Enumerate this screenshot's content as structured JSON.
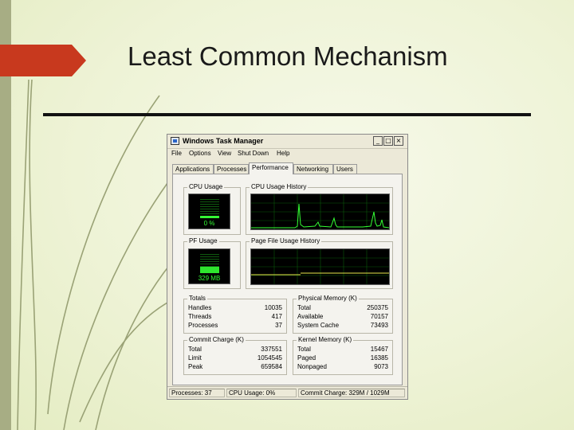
{
  "slide": {
    "title": "Least Common Mechanism",
    "accent_color": "#c8391e"
  },
  "window": {
    "title": "Windows Task Manager",
    "controls": {
      "minimize": "_",
      "maximize": "□",
      "close": "×"
    },
    "menu": [
      "File",
      "Options",
      "View",
      "Shut Down",
      "Help"
    ],
    "tabs": [
      "Applications",
      "Processes",
      "Performance",
      "Networking",
      "Users"
    ],
    "active_tab": "Performance"
  },
  "performance": {
    "cpu_usage": {
      "label": "CPU Usage",
      "value": "0 %",
      "fraction": 0.0
    },
    "cpu_history": {
      "label": "CPU Usage History",
      "line_color": "#34ff34"
    },
    "pf_usage": {
      "label": "PF Usage",
      "value": "329 MB"
    },
    "pf_history": {
      "label": "Page File Usage History",
      "line_color": "#e8e84a"
    },
    "totals": {
      "label": "Totals",
      "rows": [
        {
          "name": "Handles",
          "value": "10035"
        },
        {
          "name": "Threads",
          "value": "417"
        },
        {
          "name": "Processes",
          "value": "37"
        }
      ]
    },
    "physical_memory": {
      "label": "Physical Memory (K)",
      "rows": [
        {
          "name": "Total",
          "value": "250375"
        },
        {
          "name": "Available",
          "value": "70157"
        },
        {
          "name": "System Cache",
          "value": "73493"
        }
      ]
    },
    "commit_charge": {
      "label": "Commit Charge (K)",
      "rows": [
        {
          "name": "Total",
          "value": "337551"
        },
        {
          "name": "Limit",
          "value": "1054545"
        },
        {
          "name": "Peak",
          "value": "659584"
        }
      ]
    },
    "kernel_memory": {
      "label": "Kernel Memory (K)",
      "rows": [
        {
          "name": "Total",
          "value": "15467"
        },
        {
          "name": "Paged",
          "value": "16385"
        },
        {
          "name": "Nonpaged",
          "value": "9073"
        }
      ]
    }
  },
  "status": {
    "processes": "Processes: 37",
    "cpu": "CPU Usage: 0%",
    "commit": "Commit Charge: 329M / 1029M"
  }
}
